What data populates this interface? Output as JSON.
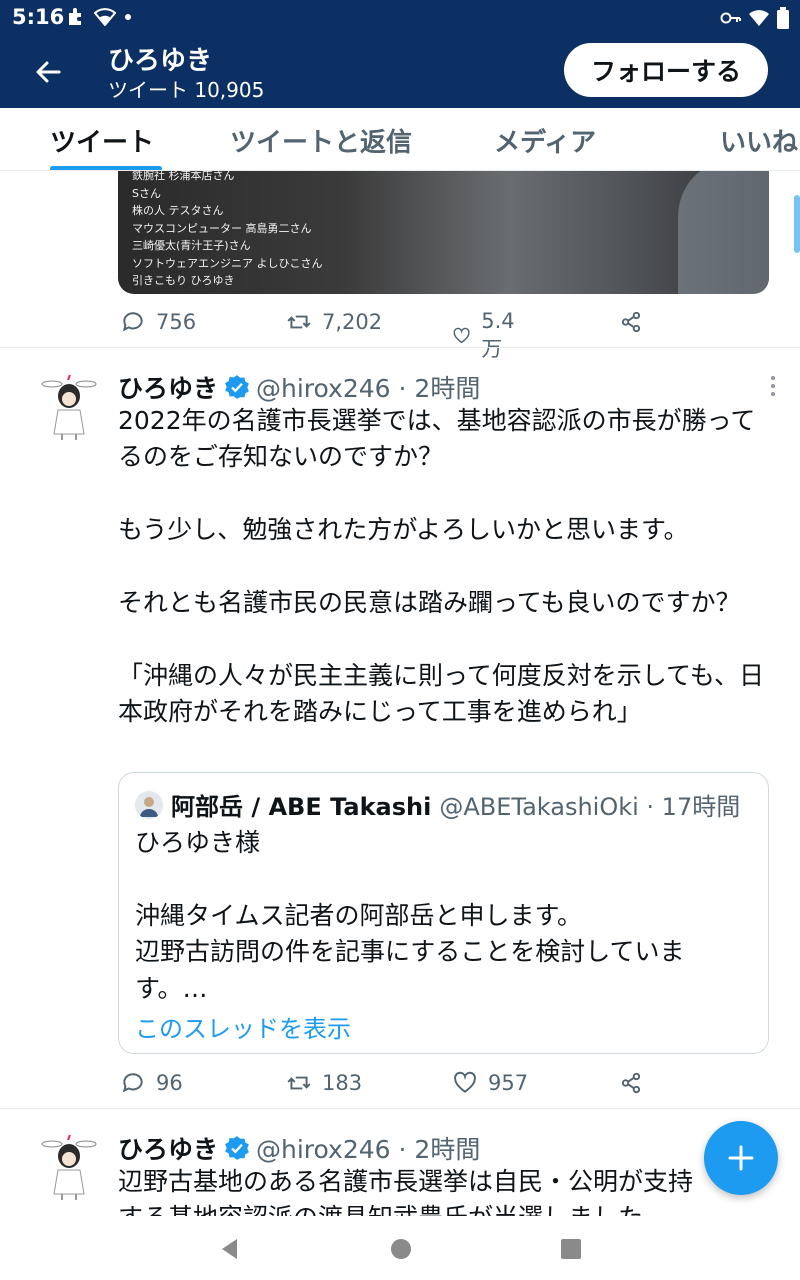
{
  "status_bar": {
    "time": "5:16",
    "left_icons": [
      "puzzle-icon",
      "wifi-icon",
      "dot-icon"
    ],
    "right_icons": [
      "key-icon",
      "wifi-icon",
      "battery-icon"
    ]
  },
  "app_bar": {
    "title": "ひろゆき",
    "subtitle": "ツイート 10,905",
    "follow_label": "フォローする"
  },
  "tabs": [
    {
      "label": "ツイート",
      "active": true
    },
    {
      "label": "ツイートと返信",
      "active": false
    },
    {
      "label": "メディア",
      "active": false
    },
    {
      "label": "いいね",
      "active": false
    }
  ],
  "top_tweet": {
    "media_credits": [
      "鉄腕社 杉浦本店さん",
      "Sさん",
      "株の人 テスタさん",
      "マウスコンピューター 高島勇二さん",
      "三崎優太(青汁王子)さん",
      "ソフトウェアエンジニア よしひこさん",
      "引きこもり ひろゆき"
    ],
    "replies": "756",
    "retweets": "7,202",
    "likes": "5.4万"
  },
  "tweet1": {
    "name": "ひろゆき",
    "handle": "@hirox246 · 2時間",
    "text": "2022年の名護市長選挙では、基地容認派の市長が勝ってるのをご存知ないのですか？\n\nもう少し、勉強された方がよろしいかと思います。\n\nそれとも名護市民の民意は踏み躙っても良いのですか？\n\n「沖縄の人々が民主主義に則って何度反対を示しても、日本政府がそれを踏みにじって工事を進められ」",
    "quote": {
      "name": "阿部岳 / ABE Takashi",
      "handle": "@ABETakashiOki · 17時間",
      "text": "ひろゆき様\n\n沖縄タイムス記者の阿部岳と申します。\n辺野古訪問の件を記事にすることを検討しています。…",
      "link": "このスレッドを表示"
    },
    "replies": "96",
    "retweets": "183",
    "likes": "957"
  },
  "tweet2": {
    "name": "ひろゆき",
    "handle": "@hirox246 · 2時間",
    "text": "辺野古基地のある名護市長選挙は自民・公明が支持する基地容認派の渡具知武豊氏が当選しました"
  },
  "colors": {
    "header_bg": "#0d3064",
    "accent": "#1d9bf0",
    "text": "#0f1419",
    "muted": "#536471"
  }
}
